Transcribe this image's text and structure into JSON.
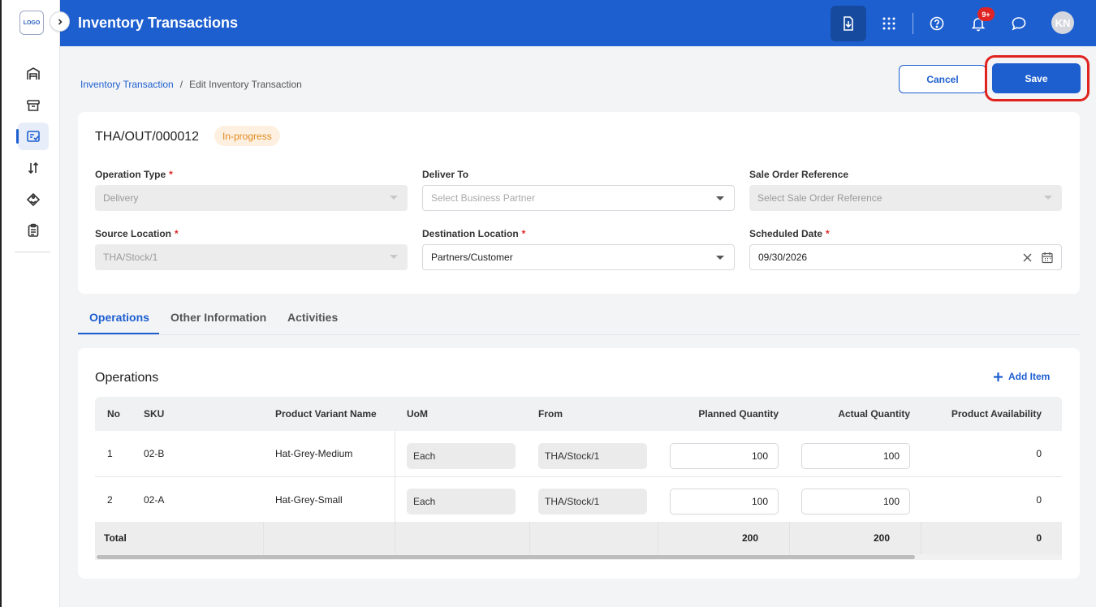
{
  "app": {
    "logo_text": "LOGO",
    "title": "Inventory Transactions"
  },
  "header": {
    "notification_badge": "9+",
    "avatar_initials": "KN"
  },
  "breadcrumb": {
    "parent": "Inventory Transaction",
    "separator": "/",
    "current": "Edit Inventory Transaction"
  },
  "actions": {
    "cancel_label": "Cancel",
    "save_label": "Save"
  },
  "document": {
    "number": "THA/OUT/000012",
    "status": "In-progress"
  },
  "form": {
    "operation_type": {
      "label": "Operation Type",
      "value": "Delivery"
    },
    "deliver_to": {
      "label": "Deliver To",
      "placeholder": "Select Business Partner"
    },
    "sale_order_reference": {
      "label": "Sale Order Reference",
      "placeholder": "Select Sale Order Reference"
    },
    "source_location": {
      "label": "Source Location",
      "value": "THA/Stock/1"
    },
    "destination_location": {
      "label": "Destination Location",
      "value": "Partners/Customer"
    },
    "scheduled_date": {
      "label": "Scheduled Date",
      "value": "09/30/2026"
    }
  },
  "tabs": [
    "Operations",
    "Other Information",
    "Activities"
  ],
  "operations": {
    "title": "Operations",
    "add_item_label": "Add Item",
    "columns": [
      "No",
      "SKU",
      "Product Variant Name",
      "UoM",
      "From",
      "Planned Quantity",
      "Actual Quantity",
      "Product Availability"
    ],
    "rows": [
      {
        "no": "1",
        "sku": "02-B",
        "name": "Hat-Grey-Medium",
        "uom": "Each",
        "from": "THA/Stock/1",
        "planned": "100",
        "actual": "100",
        "availability": "0"
      },
      {
        "no": "2",
        "sku": "02-A",
        "name": "Hat-Grey-Small",
        "uom": "Each",
        "from": "THA/Stock/1",
        "planned": "100",
        "actual": "100",
        "availability": "0"
      }
    ],
    "total": {
      "label": "Total",
      "planned": "200",
      "actual": "200",
      "availability": "0"
    }
  },
  "colors": {
    "primary": "#1e5fd0",
    "status_text": "#e08a1e",
    "highlight_ring": "#e0231e"
  }
}
